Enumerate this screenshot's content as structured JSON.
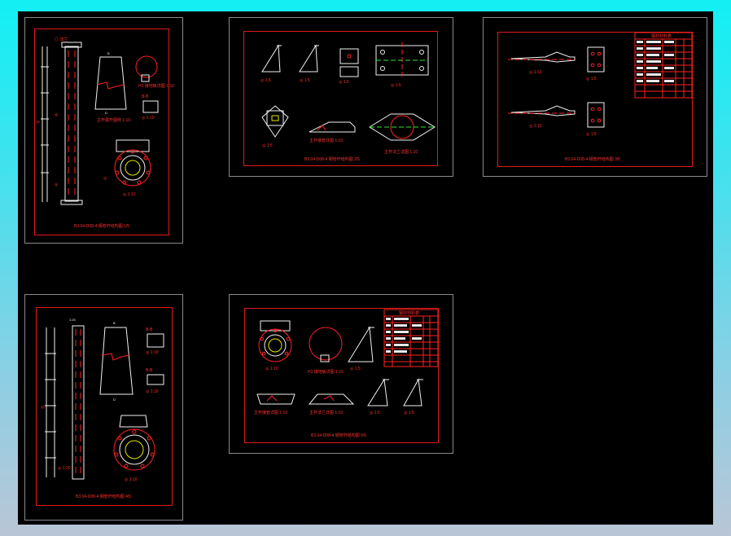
{
  "viewport": {
    "background": "#000000",
    "frame_color": "#e01a1a",
    "border_color": "#8a8a8a"
  },
  "sheets": [
    {
      "id": "sheet-1",
      "title": "B3.04-D08-4 钢管杆结构图 1/5"
    },
    {
      "id": "sheet-2",
      "title": "B3.04-D08-4 钢管杆结构图 2/5"
    },
    {
      "id": "sheet-3",
      "title": "B3.04-D08-4 钢管杆结构图 3/5"
    },
    {
      "id": "sheet-4",
      "title": "B3.04-D08-4 钢管杆结构图 4/5"
    },
    {
      "id": "sheet-5",
      "title": "B3.04-D08-4 钢管杆结构图 5/5"
    }
  ],
  "material_table": {
    "title": "钢材材料表"
  }
}
